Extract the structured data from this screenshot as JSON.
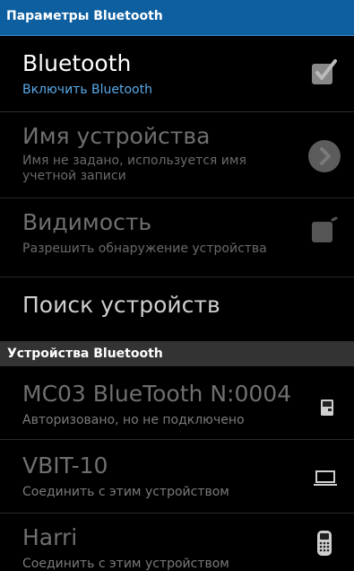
{
  "header": {
    "title": "Параметры Bluetooth"
  },
  "settings": {
    "bluetooth": {
      "title": "Bluetooth",
      "subtitle": "Включить Bluetooth",
      "checked": true
    },
    "device_name": {
      "title": "Имя устройства",
      "subtitle_line1": "Имя не задано, используется имя",
      "subtitle_line2": "учетной записи"
    },
    "visibility": {
      "title": "Видимость",
      "subtitle": "Разрешить обнаружение устройства",
      "checked": false
    },
    "search": {
      "title": "Поиск устройств"
    }
  },
  "devices_section": {
    "title": "Устройства Bluetooth"
  },
  "devices": [
    {
      "name": "MC03 BlueTooth N:0004",
      "status": "Авторизовано, но не подключено",
      "icon": "printer-icon"
    },
    {
      "name": "VBIT-10",
      "status": "Соединить с этим устройством",
      "icon": "laptop-icon"
    },
    {
      "name": "Harri",
      "status": "Соединить с этим устройством",
      "icon": "phone-icon"
    }
  ],
  "colors": {
    "titlebar": "#0e5fa0",
    "accent_text": "#5aa9e8",
    "section_bg": "#333333"
  }
}
